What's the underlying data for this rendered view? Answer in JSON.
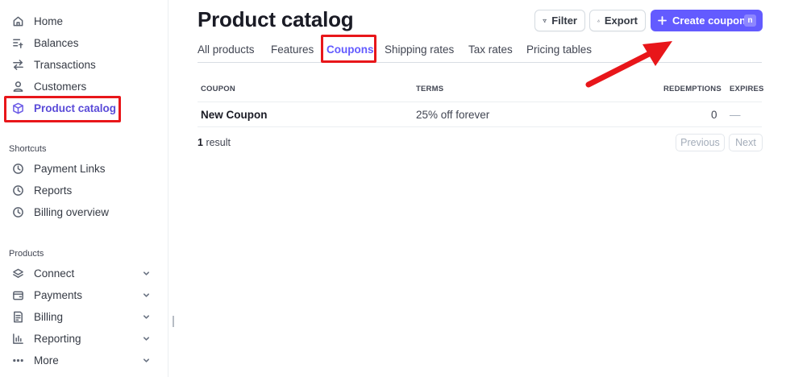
{
  "sidebar": {
    "items": [
      {
        "label": "Home",
        "icon": "home-icon"
      },
      {
        "label": "Balances",
        "icon": "balances-icon"
      },
      {
        "label": "Transactions",
        "icon": "transactions-icon"
      },
      {
        "label": "Customers",
        "icon": "customers-icon"
      },
      {
        "label": "Product catalog",
        "icon": "cube-icon",
        "active": true
      }
    ],
    "shortcuts_label": "Shortcuts",
    "shortcuts": [
      {
        "label": "Payment Links",
        "icon": "clock-icon"
      },
      {
        "label": "Reports",
        "icon": "clock-icon"
      },
      {
        "label": "Billing overview",
        "icon": "clock-icon"
      }
    ],
    "products_label": "Products",
    "products": [
      {
        "label": "Connect",
        "icon": "layers-icon"
      },
      {
        "label": "Payments",
        "icon": "wallet-icon"
      },
      {
        "label": "Billing",
        "icon": "billing-icon"
      },
      {
        "label": "Reporting",
        "icon": "chart-icon"
      },
      {
        "label": "More",
        "icon": "more-icon"
      }
    ]
  },
  "header": {
    "title": "Product catalog",
    "filter_label": "Filter",
    "export_label": "Export",
    "create_label": "Create coupon",
    "create_shortcut": "n"
  },
  "tabs": [
    {
      "label": "All products"
    },
    {
      "label": "Features"
    },
    {
      "label": "Coupons",
      "active": true
    },
    {
      "label": "Shipping rates"
    },
    {
      "label": "Tax rates"
    },
    {
      "label": "Pricing tables"
    }
  ],
  "table": {
    "columns": [
      "COUPON",
      "TERMS",
      "REDEMPTIONS",
      "EXPIRES"
    ],
    "rows": [
      {
        "coupon": "New Coupon",
        "terms": "25% off forever",
        "redemptions": "0",
        "expires": "—"
      }
    ]
  },
  "footer": {
    "result_count": "1",
    "result_label": "result",
    "previous_label": "Previous",
    "next_label": "Next"
  },
  "colors": {
    "accent": "#635bff",
    "annotation": "#e8161a"
  }
}
